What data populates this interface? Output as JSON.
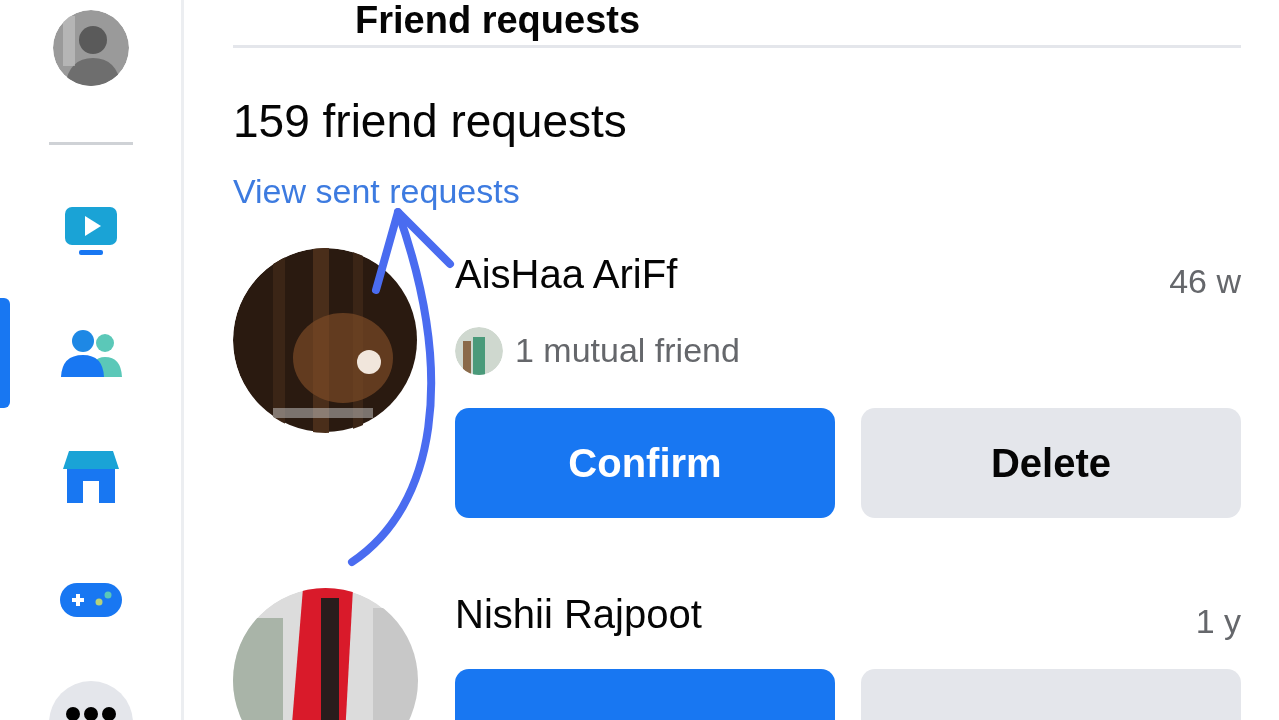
{
  "sidebar": {
    "items": [
      {
        "kind": "video",
        "selected": false
      },
      {
        "kind": "friends",
        "selected": true
      },
      {
        "kind": "store",
        "selected": false
      },
      {
        "kind": "games",
        "selected": false
      },
      {
        "kind": "more",
        "selected": false
      }
    ]
  },
  "page": {
    "title": "Friend requests",
    "count": "159 friend requests",
    "link": "View sent requests"
  },
  "requests": [
    {
      "name": "AisHaa AriFf",
      "time": "46 w",
      "mutual": "1 mutual friend",
      "buttons": [
        {
          "kind": "primary",
          "label": "Confirm"
        },
        {
          "kind": "secondary",
          "label": "Delete"
        }
      ]
    },
    {
      "name": "Nishii Rajpoot",
      "time": "1 y",
      "buttons": [
        {
          "kind": "primary"
        },
        {
          "kind": "secondary"
        }
      ]
    }
  ]
}
